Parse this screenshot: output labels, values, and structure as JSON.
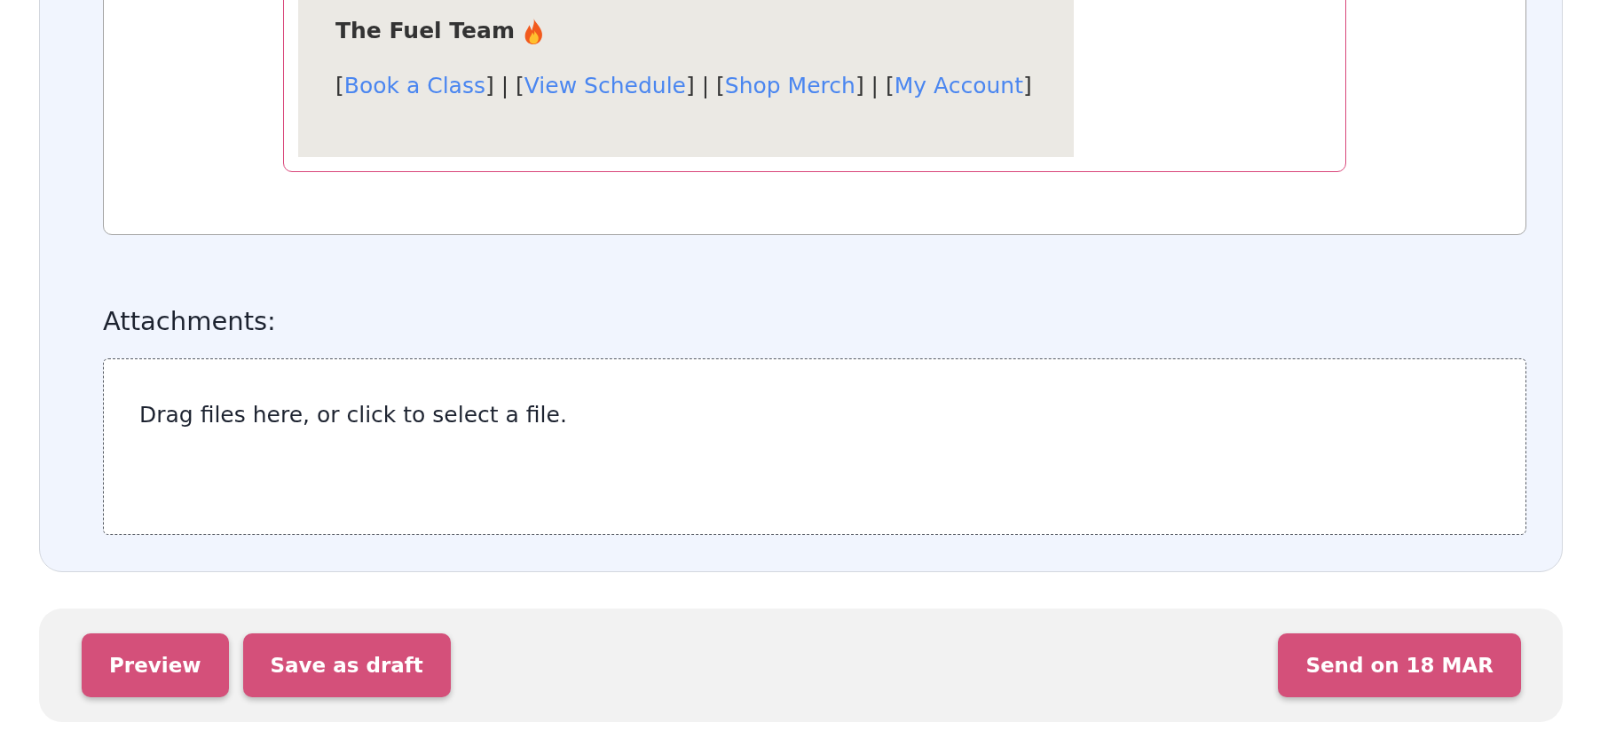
{
  "email_preview": {
    "signature": "The Fuel Team",
    "links_line": [
      {
        "kind": "text",
        "text": "["
      },
      {
        "kind": "link",
        "text": "Book a Class"
      },
      {
        "kind": "text",
        "text": "] | ["
      },
      {
        "kind": "link",
        "text": "View Schedule"
      },
      {
        "kind": "text",
        "text": "] | ["
      },
      {
        "kind": "link",
        "text": "Shop Merch"
      },
      {
        "kind": "text",
        "text": "] | ["
      },
      {
        "kind": "link",
        "text": "My Account"
      },
      {
        "kind": "text",
        "text": "]"
      }
    ]
  },
  "attachments": {
    "label": "Attachments:",
    "dropzone_text": "Drag files here, or click to select a file."
  },
  "buttons": {
    "left": [
      "Preview",
      "Save as draft"
    ],
    "right": [
      "Send on 18 MAR"
    ]
  }
}
